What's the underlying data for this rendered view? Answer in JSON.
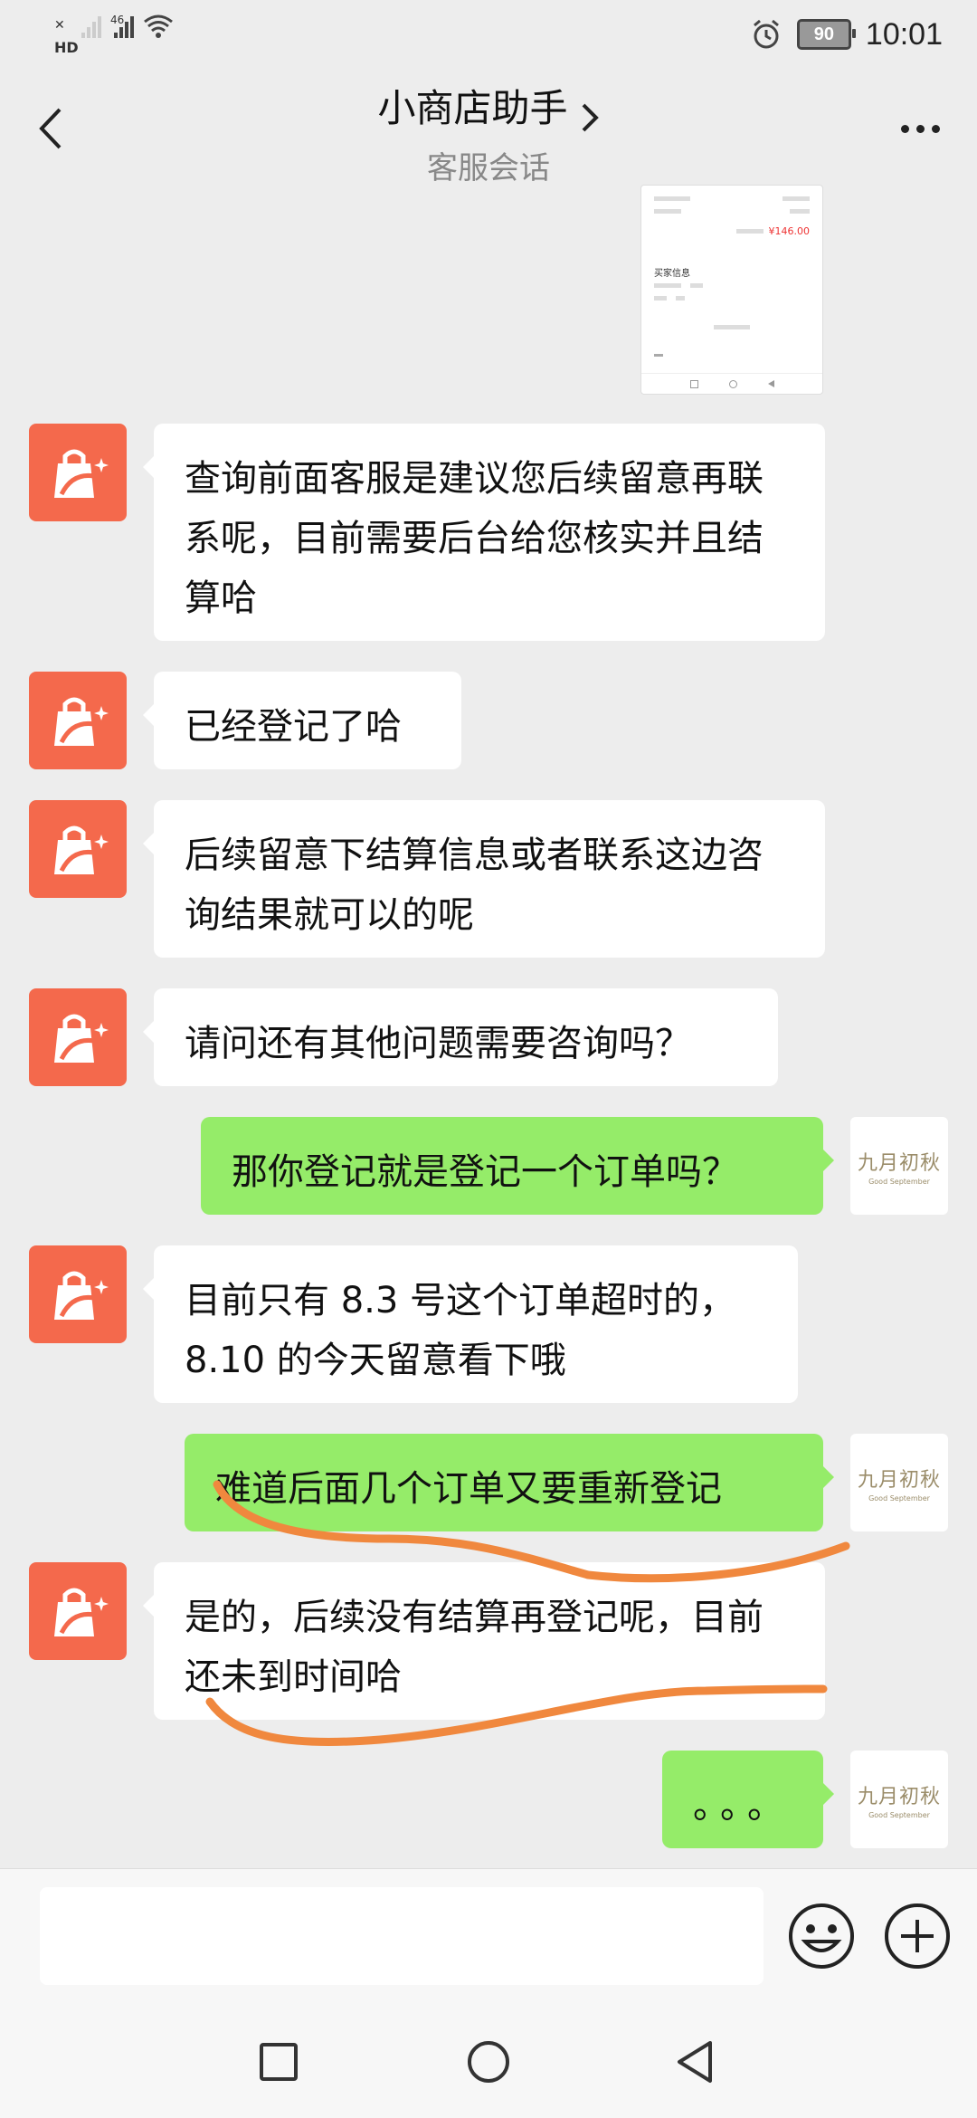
{
  "status_bar": {
    "left_labels": [
      "HD",
      "46"
    ],
    "battery": "90",
    "time": "10:01"
  },
  "header": {
    "title": "小商店助手",
    "subtitle": "客服会话"
  },
  "thumbnail": {
    "price": "¥146.00",
    "section_label": "买家信息"
  },
  "messages": [
    {
      "side": "left",
      "text": "查询前面客服是建议您后续留意再联系呢，目前需要后台给您核实并且结算哈"
    },
    {
      "side": "left",
      "text": "已经登记了哈"
    },
    {
      "side": "left",
      "text": "后续留意下结算信息或者联系这边咨询结果就可以的呢"
    },
    {
      "side": "left",
      "text": "请问还有其他问题需要咨询吗？"
    },
    {
      "side": "right",
      "text": "那你登记就是登记一个订单吗？"
    },
    {
      "side": "left",
      "text": "目前只有 8.3 号这个订单超时的，8.10 的今天留意看下哦"
    },
    {
      "side": "right",
      "text": "难道后面几个订单又要重新登记"
    },
    {
      "side": "left",
      "text": "是的，后续没有结算再登记呢，目前还未到时间哈"
    },
    {
      "side": "right",
      "text": "。。。"
    }
  ],
  "user_avatar": {
    "main": "九月初秋",
    "sub": "Good September"
  },
  "input": {
    "placeholder": ""
  },
  "colors": {
    "bot_avatar": "#f4694c",
    "user_bubble": "#95ec69",
    "annotation": "#f0883e"
  }
}
